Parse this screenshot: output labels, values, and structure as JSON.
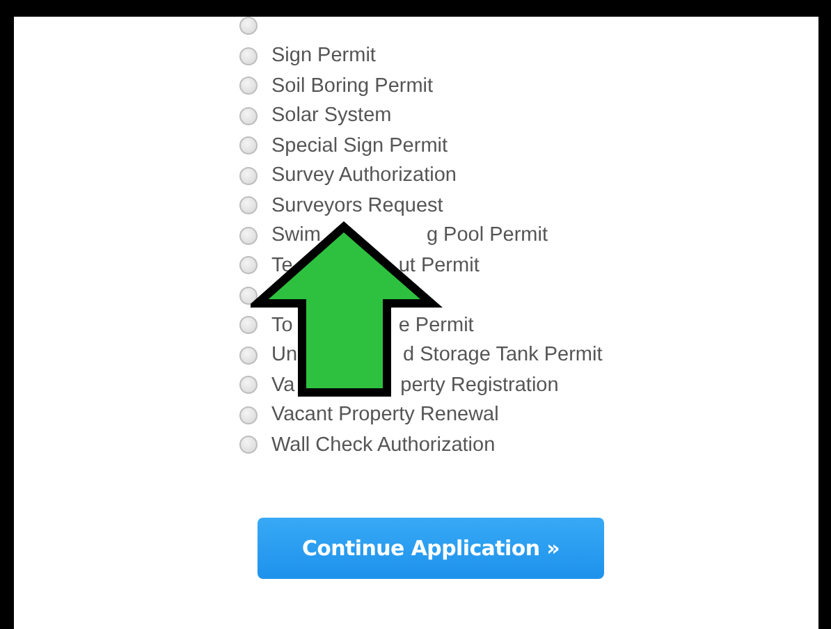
{
  "permits": [
    {
      "selected": false
    },
    {
      "parts": [
        "Sign Permit"
      ],
      "selected": false
    },
    {
      "parts": [
        "Soil Boring Permit"
      ],
      "selected": false
    },
    {
      "parts": [
        "Solar System"
      ],
      "selected": false
    },
    {
      "parts": [
        "Special Sign Permit"
      ],
      "selected": false
    },
    {
      "parts": [
        "Survey Authorization"
      ],
      "selected": false
    },
    {
      "parts": [
        "Surveyors Request"
      ],
      "selected": false
    },
    {
      "parts": [
        "Swim",
        "g Pool Permit"
      ],
      "selected": false
    },
    {
      "parts": [
        "Te",
        "ut Permit"
      ],
      "selected": false
    },
    {
      "selected": false
    },
    {
      "parts": [
        "To",
        "e Permit"
      ],
      "selected": false
    },
    {
      "parts": [
        "Un",
        "d Storage Tank Permit"
      ],
      "selected": false
    },
    {
      "parts": [
        "Va",
        "perty Registration"
      ],
      "selected": false
    },
    {
      "parts": [
        "Vacant Property Renewal"
      ],
      "selected": false
    },
    {
      "parts": [
        "Wall Check Authorization"
      ],
      "selected": false
    }
  ],
  "button": {
    "label": "Continue Application »"
  }
}
